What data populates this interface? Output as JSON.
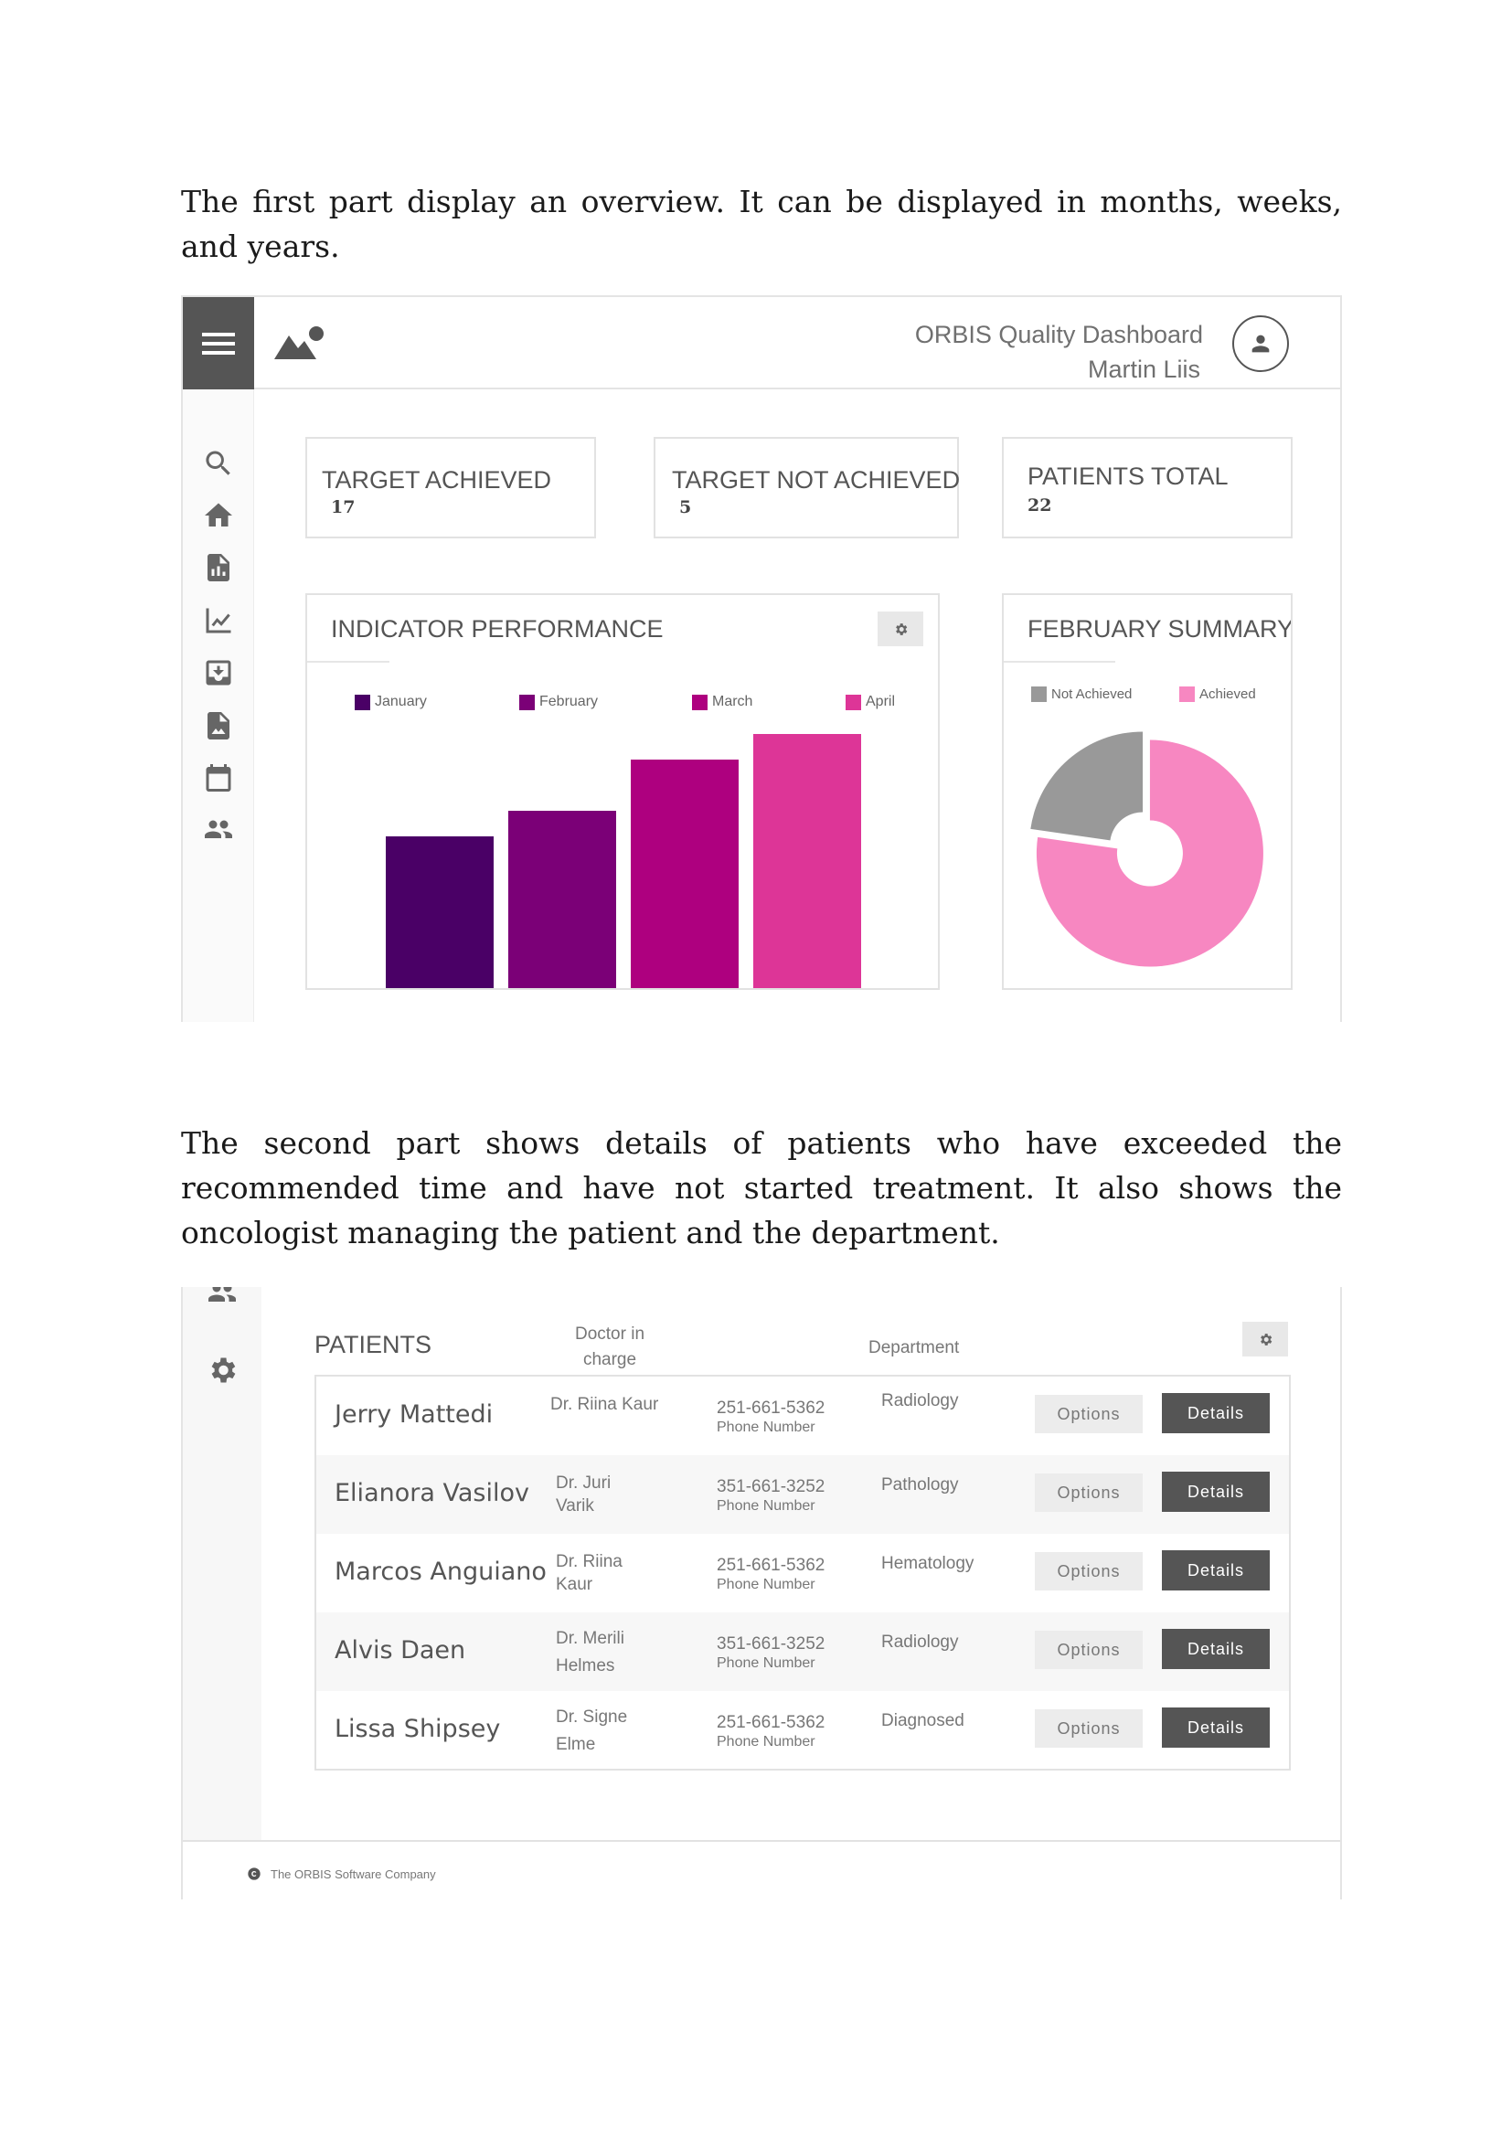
{
  "document": {
    "paragraph_1": "The first part display an overview. It can be displayed in months, weeks, and years.",
    "paragraph_2": "The second part shows details of patients who have exceeded the recommended time and have not started treatment. It also shows the oncologist managing the patient and the department."
  },
  "dashboard": {
    "header": {
      "title": "ORBIS Quality Dashboard",
      "user": "Martin Liis",
      "logo_icon": "image-icon",
      "avatar_icon": "person-icon"
    },
    "sidebar": {
      "menu_icon": "hamburger-icon",
      "icons": [
        "search-icon",
        "home-icon",
        "report-icon",
        "chart-icon",
        "inbox-icon",
        "image-file-icon",
        "calendar-icon",
        "people-icon"
      ]
    },
    "kpis": [
      {
        "label": "TARGET ACHIEVED",
        "value": "17"
      },
      {
        "label": "TARGET NOT ACHIEVED",
        "value": "5"
      },
      {
        "label": "PATIENTS TOTAL",
        "value": "22"
      }
    ],
    "indicator_card": {
      "title": "INDICATOR PERFORMANCE",
      "settings_icon": "gear-icon"
    },
    "summary_card": {
      "title": "FEBRUARY SUMMARY"
    }
  },
  "chart_data": [
    {
      "type": "bar",
      "title": "INDICATOR PERFORMANCE",
      "categories": [
        "January",
        "February",
        "March",
        "April"
      ],
      "values": [
        60,
        70,
        90,
        100
      ],
      "ylim": [
        0,
        100
      ],
      "grid": false,
      "legend": "top",
      "colors": [
        "#4a0066",
        "#7b0077",
        "#ae007f",
        "#dd3597"
      ]
    },
    {
      "type": "pie",
      "title": "FEBRUARY SUMMARY",
      "labels": [
        "Not Achieved",
        "Achieved"
      ],
      "values": [
        5,
        17
      ],
      "donut": true,
      "legend": "top",
      "colors": [
        "#999999",
        "#f787c1"
      ]
    }
  ],
  "patients": {
    "title": "PATIENTS",
    "col_doctor": "Doctor in charge",
    "col_department": "Department",
    "settings_icon": "gear-icon",
    "phone_caption": "Phone Number",
    "options_label": "Options",
    "details_label": "Details",
    "rows": [
      {
        "name": "Jerry Mattedi",
        "doctor": "Dr. Riina Kaur",
        "phone": "251-661-5362",
        "department": "Radiology"
      },
      {
        "name": "Elianora Vasilov",
        "doctor": "Dr. Juri Varik",
        "phone": "351-661-3252",
        "department": "Pathology"
      },
      {
        "name": "Marcos Anguiano",
        "doctor": "Dr. Riina Kaur",
        "phone": "251-661-5362",
        "department": "Hematology"
      },
      {
        "name": "Alvis Daen",
        "doctor": "Dr. Merili Helmes",
        "phone": "351-661-3252",
        "department": "Radiology"
      },
      {
        "name": "Lissa Shipsey",
        "doctor": "Dr. Signe Elme",
        "phone": "251-661-5362",
        "department": "Diagnosed"
      }
    ],
    "footer": "The ORBIS Software Company",
    "footer_icon": "copyright-icon",
    "sidebar_icons": [
      "people-icon",
      "gear-icon"
    ]
  }
}
